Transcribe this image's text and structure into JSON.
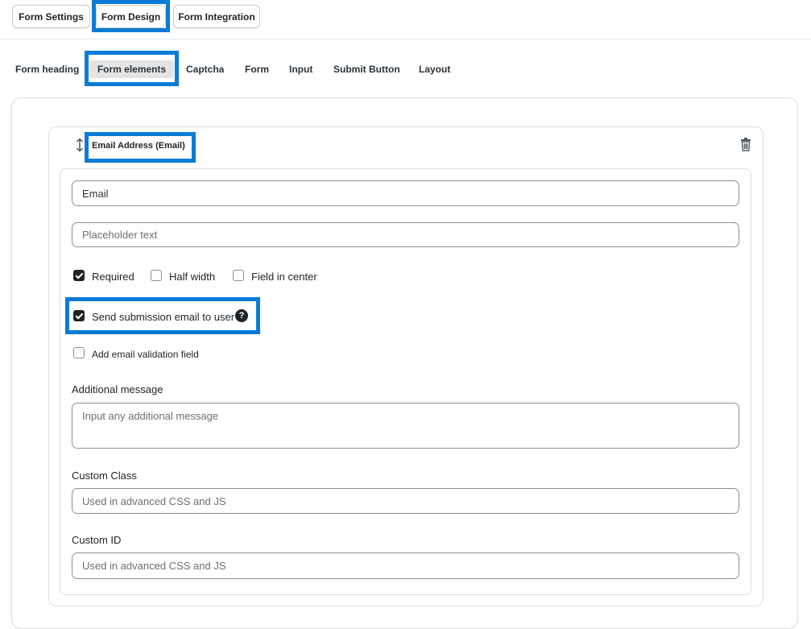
{
  "top_tabs": [
    {
      "label": "Form Settings"
    },
    {
      "label": "Form Design"
    },
    {
      "label": "Form Integration"
    }
  ],
  "sub_tabs": [
    {
      "label": "Form heading"
    },
    {
      "label": "Form elements"
    },
    {
      "label": "Captcha"
    },
    {
      "label": "Form"
    },
    {
      "label": "Input"
    },
    {
      "label": "Submit Button"
    },
    {
      "label": "Layout"
    }
  ],
  "element": {
    "title": "Email Address (Email)",
    "label_value": "Email",
    "placeholder_field_placeholder": "Placeholder text",
    "checkboxes": [
      {
        "label": "Required",
        "checked": true
      },
      {
        "label": "Half width",
        "checked": false
      },
      {
        "label": "Field in center",
        "checked": false
      }
    ],
    "send_email": {
      "label": "Send submission email to user",
      "checked": true
    },
    "validation": {
      "label": "Add email validation field",
      "checked": false
    },
    "additional_message": {
      "label": "Additional message",
      "placeholder": "Input any additional message"
    },
    "custom_class": {
      "label": "Custom Class",
      "placeholder": "Used in advanced CSS and JS"
    },
    "custom_id": {
      "label": "Custom ID",
      "placeholder": "Used in advanced CSS and JS"
    }
  },
  "icons": {
    "drag": "drag-handle-icon",
    "delete": "trash-icon",
    "help": "help-icon"
  },
  "colors": {
    "highlight": "#0a7bd6",
    "checkbox_checked": "#1d2327"
  }
}
